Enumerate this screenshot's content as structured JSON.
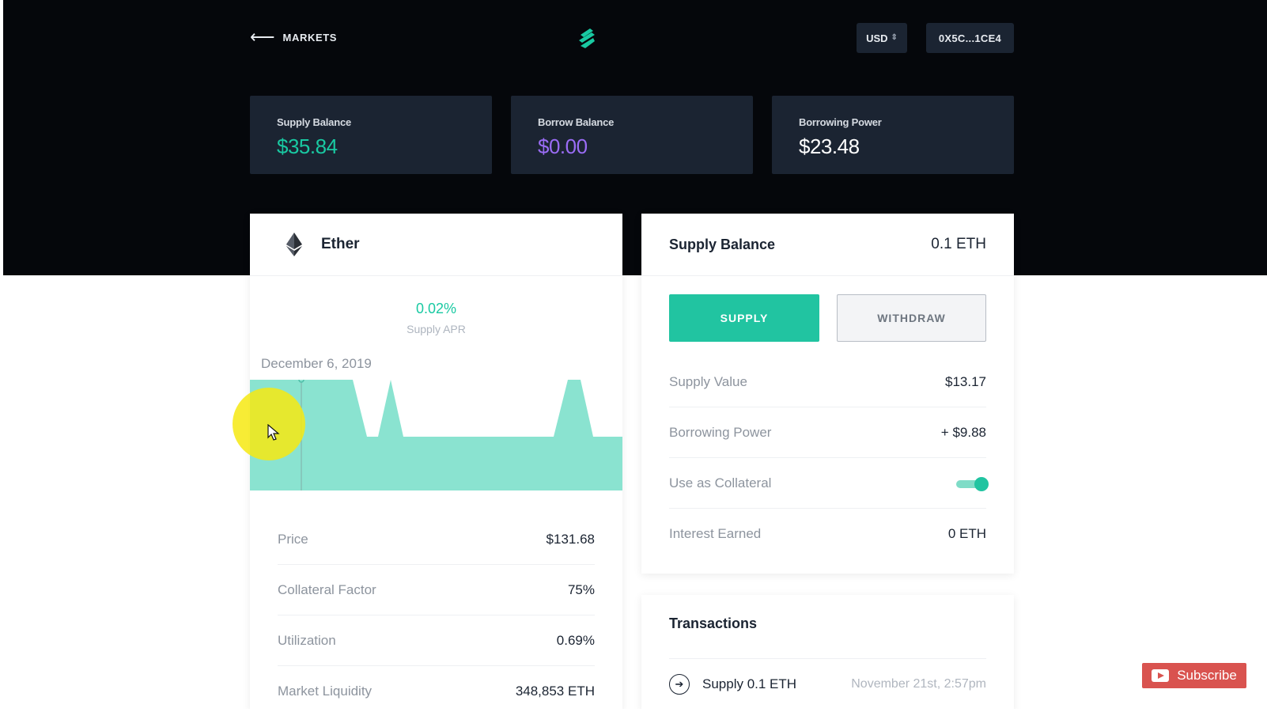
{
  "header": {
    "back_label": "MARKETS",
    "currency": "USD",
    "wallet": "0X5C...1CE4"
  },
  "stats": [
    {
      "label": "Supply Balance",
      "value": "$35.84",
      "color": "#19c9a2"
    },
    {
      "label": "Borrow Balance",
      "value": "$0.00",
      "color": "#9a6cf5"
    },
    {
      "label": "Borrowing Power",
      "value": "$23.48",
      "color": "#ffffff"
    }
  ],
  "market": {
    "name": "Ether",
    "apr_value": "0.02%",
    "apr_label": "Supply APR",
    "chart_date": "December 6, 2019",
    "chart_color": "#8ae3d0",
    "details": [
      {
        "label": "Price",
        "value": "$131.68"
      },
      {
        "label": "Collateral Factor",
        "value": "75%"
      },
      {
        "label": "Utilization",
        "value": "0.69%"
      },
      {
        "label": "Market Liquidity",
        "value": "348,853 ETH"
      }
    ]
  },
  "supply_panel": {
    "title": "Supply Balance",
    "amount": "0.1 ETH",
    "supply_button": "SUPPLY",
    "withdraw_button": "WITHDRAW",
    "rows": [
      {
        "label": "Supply Value",
        "value": "$13.17"
      },
      {
        "label": "Borrowing Power",
        "value": "+ $9.88"
      },
      {
        "label": "Use as Collateral",
        "value": "",
        "toggle_on": true
      },
      {
        "label": "Interest Earned",
        "value": "0 ETH"
      }
    ]
  },
  "transactions": {
    "title": "Transactions",
    "items": [
      {
        "description": "Supply 0.1 ETH",
        "date": "November 21st, 2:57pm"
      }
    ]
  },
  "overlay": {
    "subscribe_label": "Subscribe"
  },
  "colors": {
    "accent": "#21c4a1",
    "header_bg": "#05070b",
    "card_dark": "#1b2432"
  }
}
